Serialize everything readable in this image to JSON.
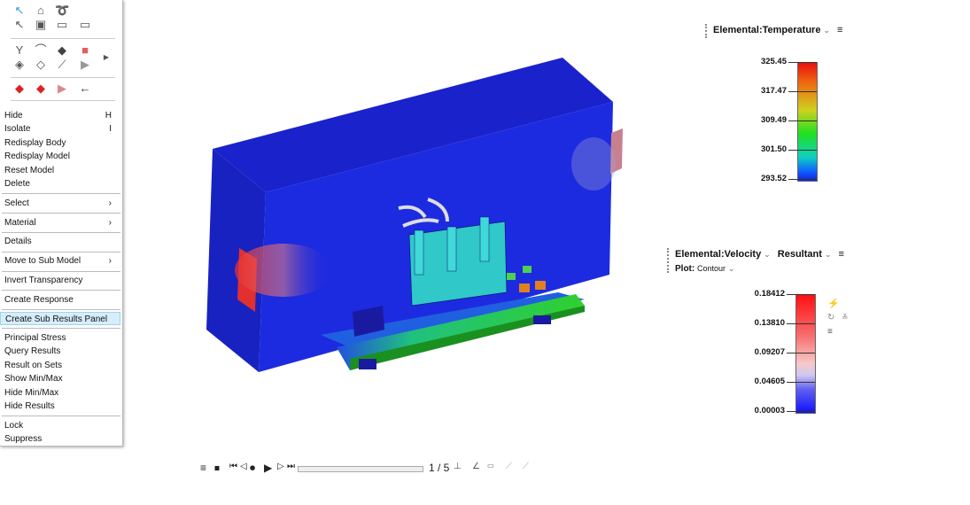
{
  "toolbar_icons": [
    "select-arrow-icon",
    "freehand-select-icon",
    "lasso-icon",
    "select-filter-icon",
    "window-icon",
    "box-icon",
    "box-outline-icon",
    "beam-icon",
    "curve-icon",
    "surface-icon",
    "solid-icon",
    "shell-icon",
    "face-icon",
    "line-icon",
    "wedge-icon",
    "expand-icon",
    "delete-solid-icon",
    "delete-body-icon",
    "delete-wedge-icon",
    "back-arrow-icon"
  ],
  "menu": {
    "items": [
      {
        "label": "Hide",
        "key": "H"
      },
      {
        "label": "Isolate",
        "key": "I"
      },
      {
        "label": "Redisplay Body"
      },
      {
        "label": "Redisplay Model"
      },
      {
        "label": "Reset Model"
      },
      {
        "label": "Delete"
      },
      {
        "label": "Select",
        "key": "›"
      },
      {
        "label": "Material",
        "key": "›"
      },
      {
        "label": "Details"
      },
      {
        "label": "Move to Sub Model",
        "key": "›"
      },
      {
        "label": "Invert Transparency"
      },
      {
        "label": "Create Response"
      },
      {
        "label": "Create Sub Results Panel"
      },
      {
        "label": "Principal Stress"
      },
      {
        "label": "Query Results"
      },
      {
        "label": "Result on Sets"
      },
      {
        "label": "Show Min/Max"
      },
      {
        "label": "Hide Min/Max"
      },
      {
        "label": "Hide Results"
      },
      {
        "label": "Lock"
      },
      {
        "label": "Suppress"
      }
    ]
  },
  "legend1": {
    "title": "Elemental:Temperature",
    "labels": [
      "325.45",
      "317.47",
      "309.49",
      "301.50",
      "293.52"
    ]
  },
  "legend2": {
    "title": "Elemental:Velocity",
    "component": "Resultant",
    "plot_label": "Plot:",
    "plot_value": "Contour",
    "labels": [
      "0.18412",
      "0.13810",
      "0.09207",
      "0.04605",
      "0.00003"
    ]
  },
  "playback": {
    "frame": "1 / 5",
    "progress": 0
  }
}
